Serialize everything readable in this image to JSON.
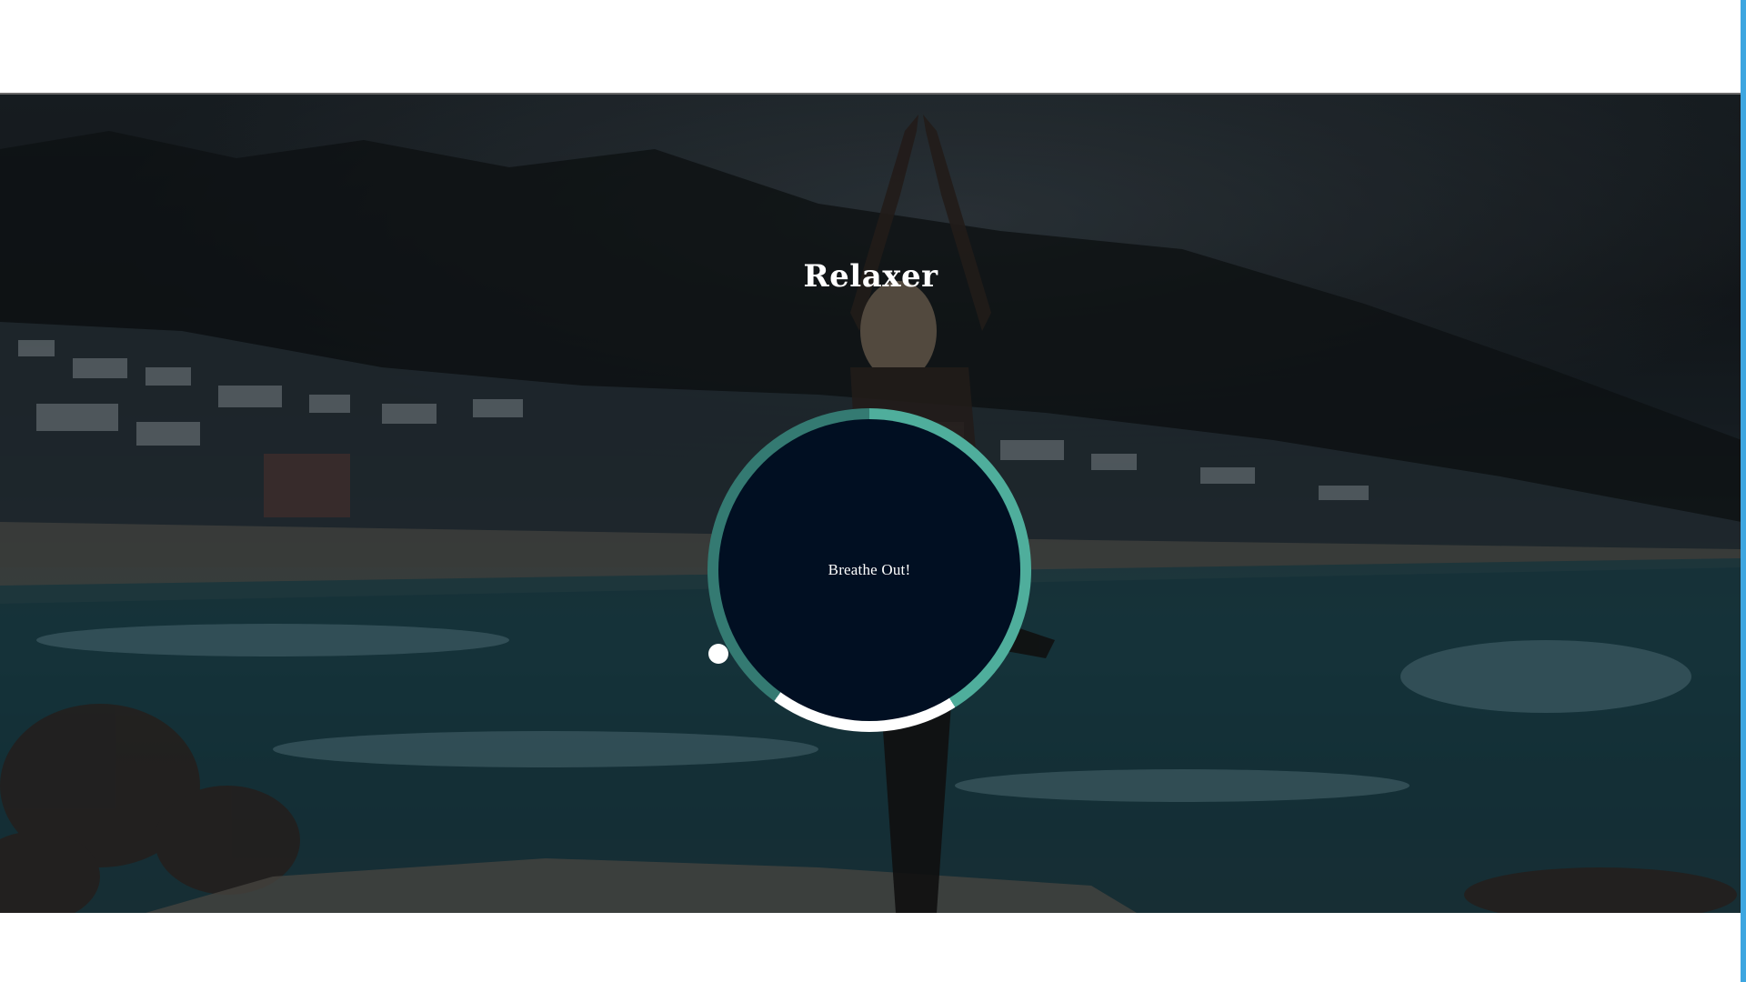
{
  "app": {
    "title": "Relaxer"
  },
  "breather": {
    "status_text": "Breathe Out!",
    "pointer_angle_deg": -119,
    "segments": [
      {
        "name": "breathe-in",
        "color": "#4fae9c",
        "from_deg": 0,
        "to_deg": 148
      },
      {
        "name": "hold",
        "color": "#ffffff",
        "from_deg": 148,
        "to_deg": 216
      },
      {
        "name": "breathe-out",
        "color": "#347a72",
        "from_deg": 216,
        "to_deg": 360
      }
    ]
  },
  "colors": {
    "circle_fill": "#010f22",
    "accent_scrollbar": "#3ea6e0",
    "text": "#ffffff"
  }
}
